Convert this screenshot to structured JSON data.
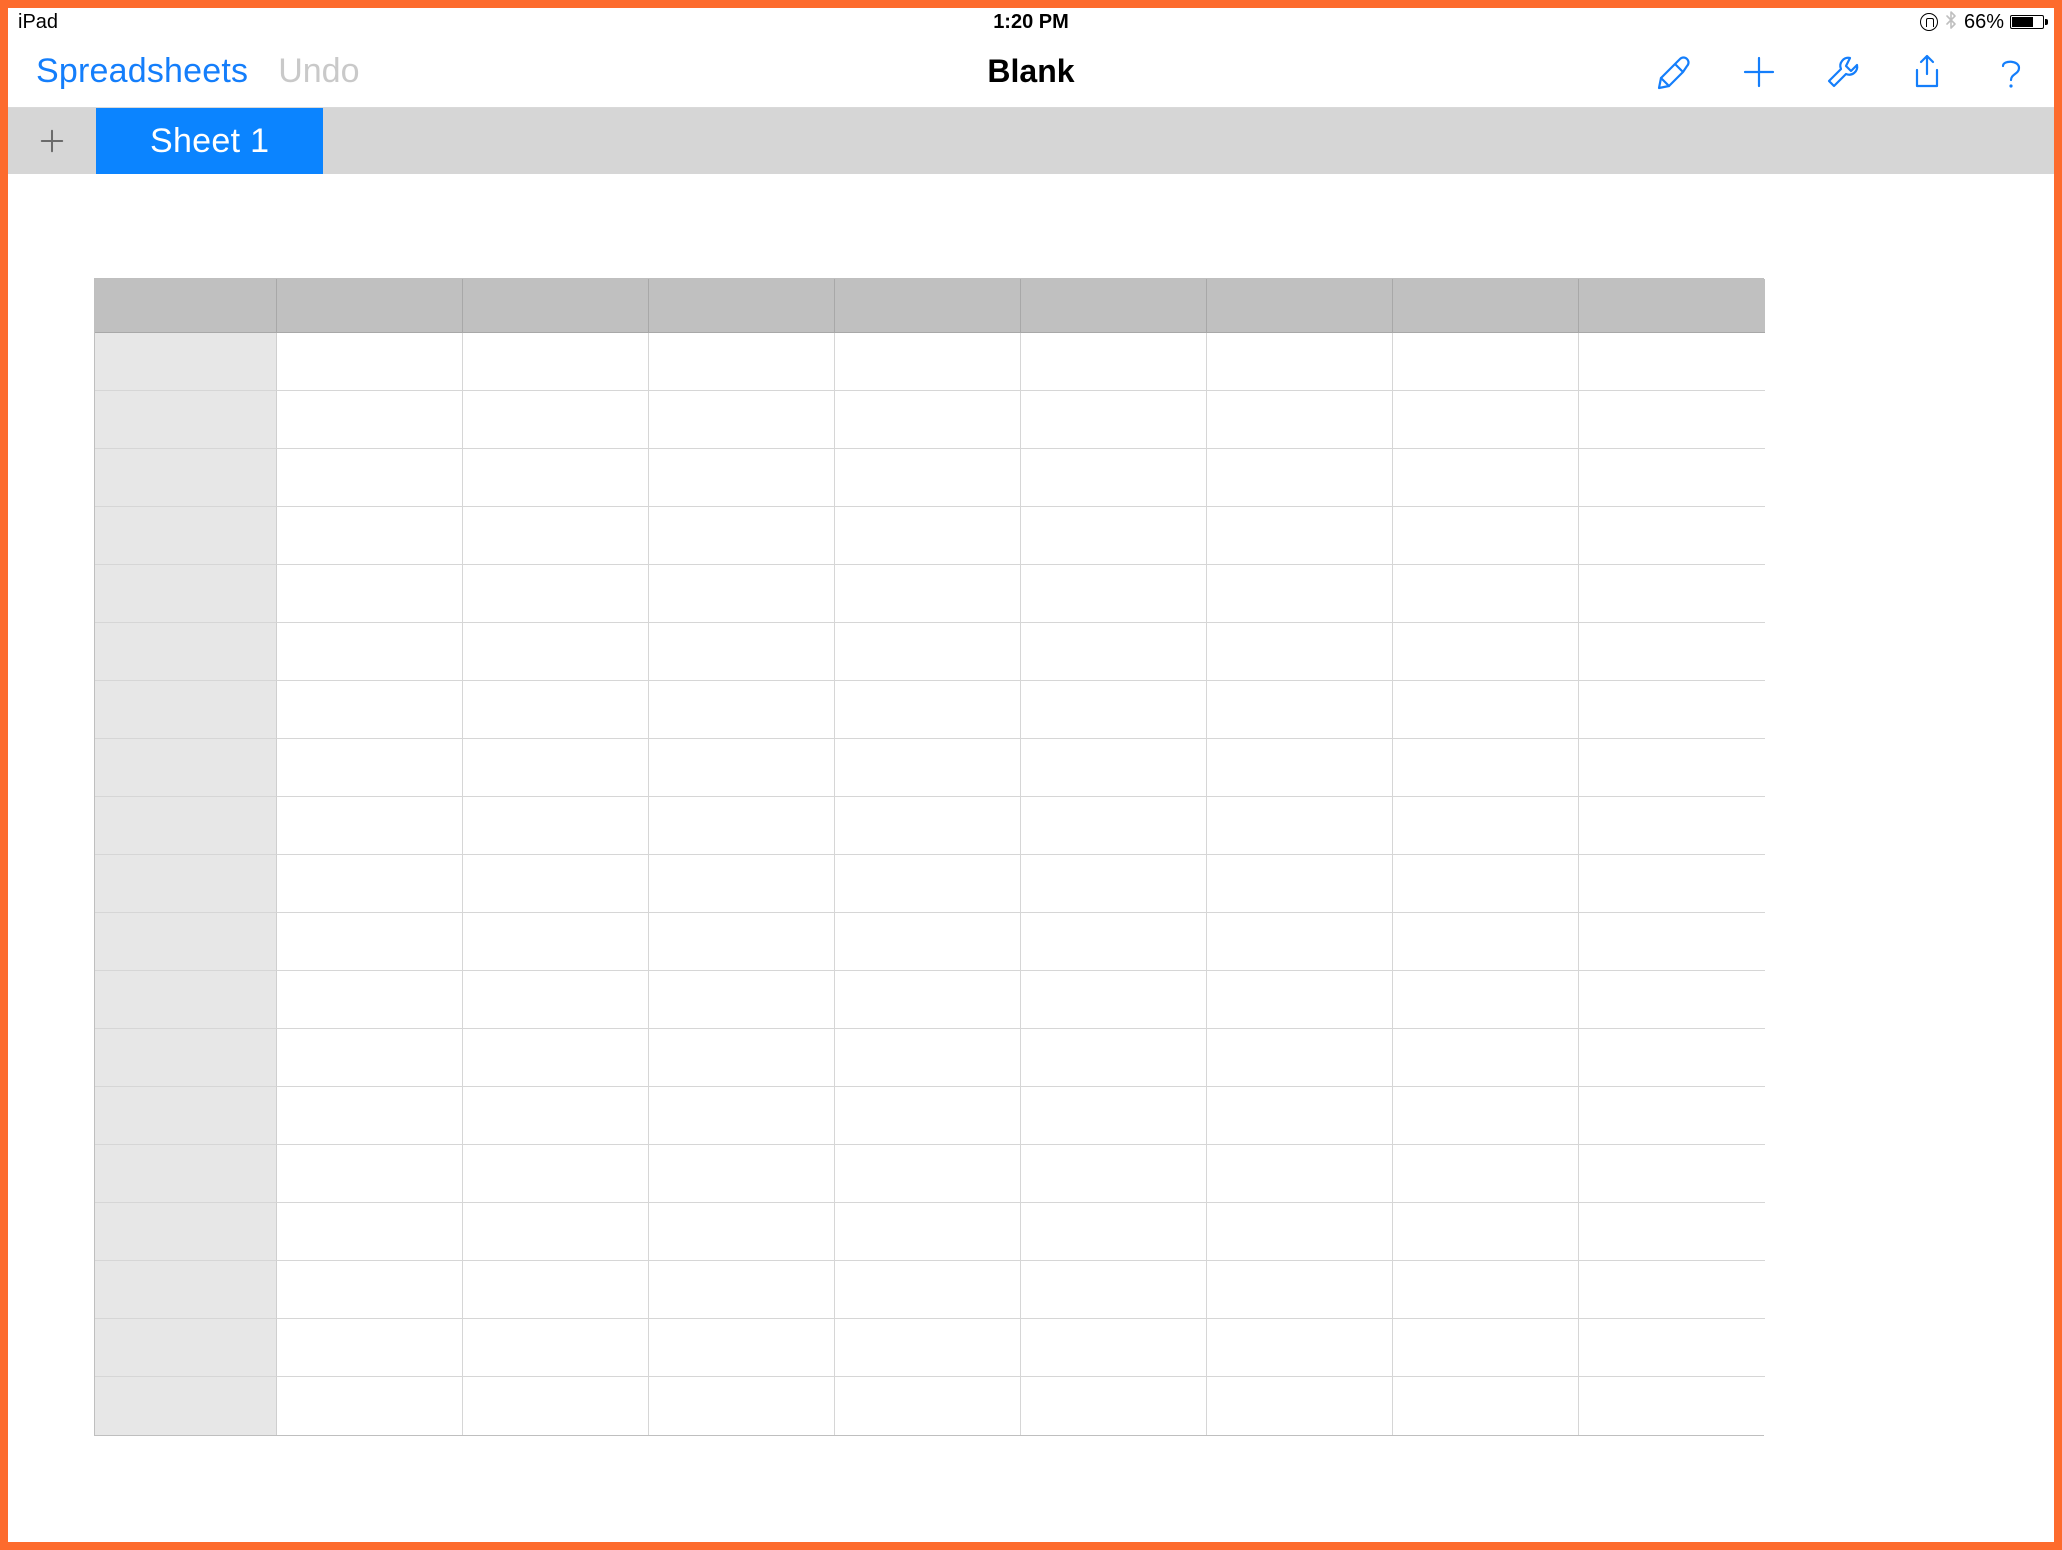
{
  "status_bar": {
    "device": "iPad",
    "time": "1:20 PM",
    "battery_percent": "66%",
    "orientation_lock_icon": "orientation-lock-icon",
    "bluetooth_icon": "bluetooth-icon"
  },
  "toolbar": {
    "back_label": "Spreadsheets",
    "undo_label": "Undo",
    "title": "Blank",
    "icons": {
      "paint": "format-brush-icon",
      "add": "plus-icon",
      "tools": "wrench-icon",
      "share": "share-icon",
      "help": "help-icon"
    }
  },
  "tabs": {
    "add_icon": "plus-icon",
    "active_tab_label": "Sheet 1"
  },
  "grid": {
    "columns": 8,
    "rows": 19,
    "column_headers": [
      "",
      "",
      "",
      "",
      "",
      "",
      "",
      ""
    ],
    "row_headers": [
      "",
      "",
      "",
      "",
      "",
      "",
      "",
      "",
      "",
      "",
      "",
      "",
      "",
      "",
      "",
      "",
      "",
      "",
      ""
    ],
    "cells": []
  },
  "colors": {
    "accent": "#147efb",
    "tab_active": "#0b84ff",
    "frame": "#fd6b2d",
    "tabstrip_bg": "#d6d6d6",
    "header_cell": "#c0c0c0",
    "row_header_cell": "#e7e7e7"
  }
}
